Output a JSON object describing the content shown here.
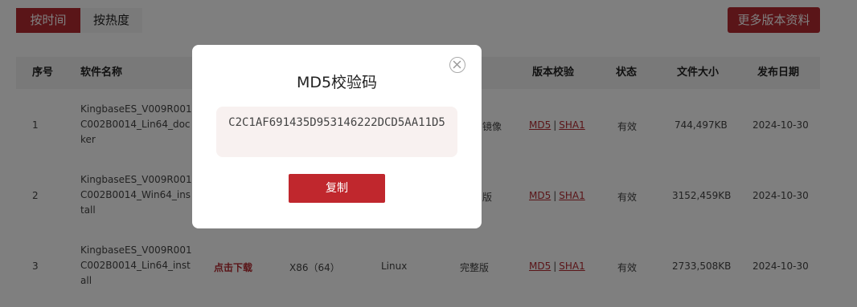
{
  "sort_tabs": {
    "by_time": "按时间",
    "by_heat": "按热度"
  },
  "more_versions": "更多版本资料",
  "table": {
    "headers": {
      "index": "序号",
      "name": "软件名称",
      "verify": "版本校验",
      "status": "状态",
      "size": "文件大小",
      "date": "发布日期"
    },
    "rows": [
      {
        "index": "1",
        "name": "KingbaseES_V009R001C002B0014_Lin64_docker",
        "type_partial": "镜像",
        "md5": "MD5",
        "sha1": "SHA1",
        "status": "有效",
        "size": "744,497KB",
        "date": "2024-10-30"
      },
      {
        "index": "2",
        "name": "KingbaseES_V009R001C002B0014_Win64_install",
        "type_partial": "版",
        "md5": "MD5",
        "sha1": "SHA1",
        "status": "有效",
        "size": "3152,459KB",
        "date": "2024-10-30"
      },
      {
        "index": "3",
        "name": "KingbaseES_V009R001C002B0014_Lin64_install",
        "download": "点击下载",
        "arch": "X86（64）",
        "os": "Linux",
        "type": "完整版",
        "md5": "MD5",
        "sha1": "SHA1",
        "status": "有效",
        "size": "2733,508KB",
        "date": "2024-10-30"
      }
    ]
  },
  "modal": {
    "title": "MD5校验码",
    "hash": "C2C1AF691435D953146222DCD5AA11D5",
    "copy_label": "复制"
  },
  "colors": {
    "brand": "#b52a31",
    "hash_bg": "#f8f1f0"
  },
  "icons": {
    "close": "close-circle-icon"
  }
}
